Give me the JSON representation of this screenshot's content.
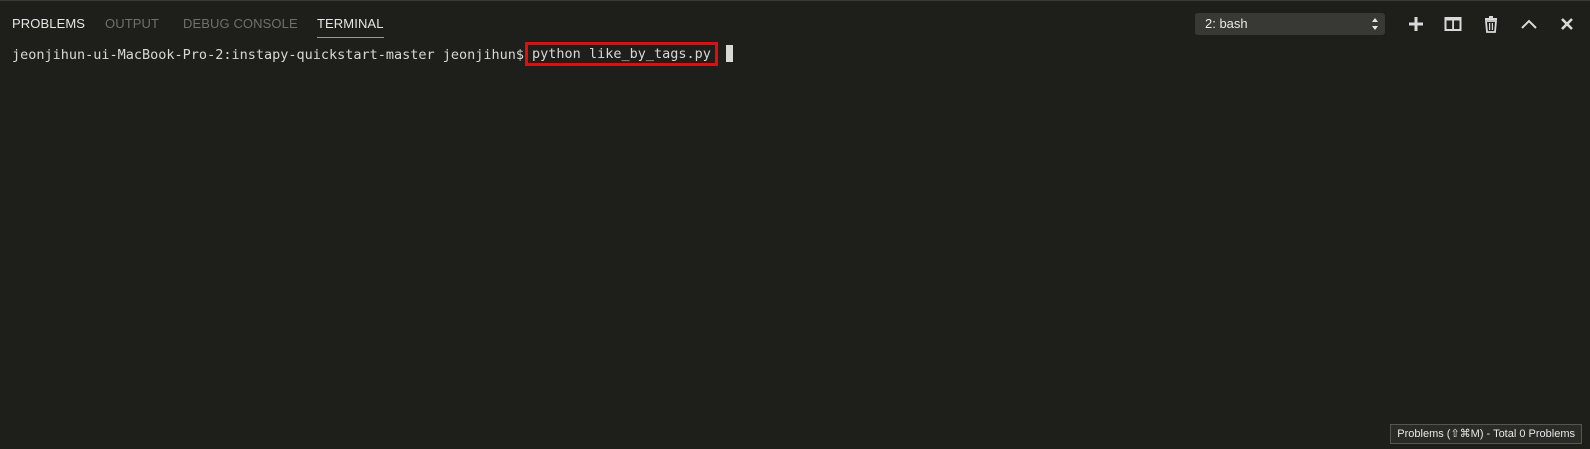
{
  "tabs": [
    {
      "id": "problems",
      "label": "PROBLEMS"
    },
    {
      "id": "output",
      "label": "OUTPUT"
    },
    {
      "id": "debug",
      "label": "DEBUG CONSOLE"
    },
    {
      "id": "terminal",
      "label": "TERMINAL",
      "active": true
    }
  ],
  "shell_select": {
    "value": "2: bash"
  },
  "actions": {
    "add_icon": "plus-icon",
    "split_icon": "split-icon",
    "trash_icon": "trash-icon",
    "maximize_icon": "chevron-up-icon",
    "close_icon": "close-icon"
  },
  "terminal": {
    "prompt": "jeonjihun-ui-MacBook-Pro-2:instapy-quickstart-master jeonjihun$",
    "command": "python like_by_tags.py"
  },
  "status": {
    "tooltip": "Problems (⇧⌘M) - Total 0 Problems"
  },
  "colors": {
    "background": "#1e1f1a",
    "highlight_box": "#e20d0d",
    "active_tab": "#e6e6e6",
    "inactive_tab": "#6f706a"
  }
}
